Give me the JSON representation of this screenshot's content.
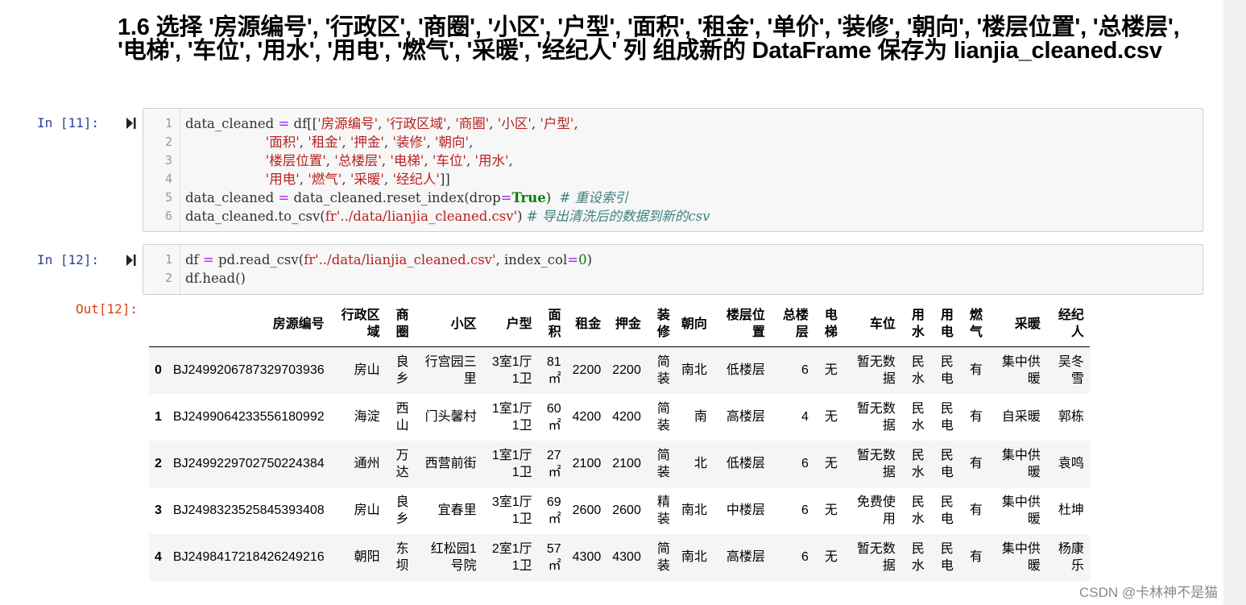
{
  "heading": "1.6  选择 '房源编号', '行政区', '商圈', '小区', '户型', '面积', '租金', '单价', '装修', '朝向', '楼层位置', '总楼层', '电梯', '车位', '用水', '用电', '燃气', '采暖', '经纪人' 列 组成新的 DataFrame 保存为 lianjia_cleaned.csv",
  "cells": [
    {
      "prompt": "In  [11]:",
      "line_numbers": [
        "1",
        "2",
        "3",
        "4",
        "5",
        "6"
      ],
      "lines": [
        [
          [
            "p",
            "data_cleaned "
          ],
          [
            "o",
            "="
          ],
          [
            "p",
            " df[["
          ],
          [
            "s",
            "'房源编号'"
          ],
          [
            "p",
            ", "
          ],
          [
            "s",
            "'行政区域'"
          ],
          [
            "p",
            ", "
          ],
          [
            "s",
            "'商圈'"
          ],
          [
            "p",
            ", "
          ],
          [
            "s",
            "'小区'"
          ],
          [
            "p",
            ", "
          ],
          [
            "s",
            "'户型'"
          ],
          [
            "p",
            ","
          ]
        ],
        [
          [
            "p",
            "                   "
          ],
          [
            "s",
            "'面积'"
          ],
          [
            "p",
            ", "
          ],
          [
            "s",
            "'租金'"
          ],
          [
            "p",
            ", "
          ],
          [
            "s",
            "'押金'"
          ],
          [
            "p",
            ", "
          ],
          [
            "s",
            "'装修'"
          ],
          [
            "p",
            ", "
          ],
          [
            "s",
            "'朝向'"
          ],
          [
            "p",
            ","
          ]
        ],
        [
          [
            "p",
            "                   "
          ],
          [
            "s",
            "'楼层位置'"
          ],
          [
            "p",
            ", "
          ],
          [
            "s",
            "'总楼层'"
          ],
          [
            "p",
            ", "
          ],
          [
            "s",
            "'电梯'"
          ],
          [
            "p",
            ", "
          ],
          [
            "s",
            "'车位'"
          ],
          [
            "p",
            ", "
          ],
          [
            "s",
            "'用水'"
          ],
          [
            "p",
            ","
          ]
        ],
        [
          [
            "p",
            "                   "
          ],
          [
            "s",
            "'用电'"
          ],
          [
            "p",
            ", "
          ],
          [
            "s",
            "'燃气'"
          ],
          [
            "p",
            ", "
          ],
          [
            "s",
            "'采暖'"
          ],
          [
            "p",
            ", "
          ],
          [
            "s",
            "'经纪人'"
          ],
          [
            "p",
            "]]"
          ]
        ],
        [
          [
            "p",
            "data_cleaned "
          ],
          [
            "o",
            "="
          ],
          [
            "p",
            " data_cleaned.reset_index(drop"
          ],
          [
            "o",
            "="
          ],
          [
            "k",
            "True"
          ],
          [
            "p",
            ")  "
          ],
          [
            "c",
            "# 重设索引"
          ]
        ],
        [
          [
            "p",
            "data_cleaned.to_csv("
          ],
          [
            "s",
            "fr'../data/lianjia_cleaned.csv'"
          ],
          [
            "p",
            ") "
          ],
          [
            "c",
            "# 导出清洗后的数据到新的csv"
          ]
        ]
      ]
    },
    {
      "prompt": "In  [12]:",
      "line_numbers": [
        "1",
        "2"
      ],
      "lines": [
        [
          [
            "p",
            "df "
          ],
          [
            "o",
            "="
          ],
          [
            "p",
            " pd.read_csv("
          ],
          [
            "s",
            "fr'../data/lianjia_cleaned.csv'"
          ],
          [
            "p",
            ", index_col"
          ],
          [
            "o",
            "="
          ],
          [
            "n",
            "0"
          ],
          [
            "p",
            ")"
          ]
        ],
        [
          [
            "p",
            "df.head()"
          ]
        ]
      ]
    }
  ],
  "output_prompt": "Out[12]:",
  "table": {
    "columns": [
      "房源编号",
      "行政区域",
      "商圈",
      "小区",
      "户型",
      "面积",
      "租金",
      "押金",
      "装修",
      "朝向",
      "楼层位置",
      "总楼层",
      "电梯",
      "车位",
      "用水",
      "用电",
      "燃气",
      "采暖",
      "经纪人"
    ],
    "rows": [
      {
        "index": "0",
        "cells": [
          "BJ2499206787329703936",
          "房山",
          "良乡",
          "行宫园三里",
          "3室1厅1卫",
          "81㎡",
          "2200",
          "2200",
          "简装",
          "南北",
          "低楼层",
          "6",
          "无",
          "暂无数据",
          "民水",
          "民电",
          "有",
          "集中供暖",
          "吴冬雪"
        ]
      },
      {
        "index": "1",
        "cells": [
          "BJ2499064233556180992",
          "海淀",
          "西山",
          "门头馨村",
          "1室1厅1卫",
          "60㎡",
          "4200",
          "4200",
          "简装",
          "南",
          "高楼层",
          "4",
          "无",
          "暂无数据",
          "民水",
          "民电",
          "有",
          "自采暖",
          "郭栋"
        ]
      },
      {
        "index": "2",
        "cells": [
          "BJ2499229702750224384",
          "通州",
          "万达",
          "西营前街",
          "1室1厅1卫",
          "27㎡",
          "2100",
          "2100",
          "简装",
          "北",
          "低楼层",
          "6",
          "无",
          "暂无数据",
          "民水",
          "民电",
          "有",
          "集中供暖",
          "袁鸣"
        ]
      },
      {
        "index": "3",
        "cells": [
          "BJ2498323525845393408",
          "房山",
          "良乡",
          "宜春里",
          "3室1厅1卫",
          "69㎡",
          "2600",
          "2600",
          "精装",
          "南北",
          "中楼层",
          "6",
          "无",
          "免费使用",
          "民水",
          "民电",
          "有",
          "集中供暖",
          "杜坤"
        ]
      },
      {
        "index": "4",
        "cells": [
          "BJ2498417218426249216",
          "朝阳",
          "东坝",
          "红松园1号院",
          "2室1厅1卫",
          "57㎡",
          "4300",
          "4300",
          "简装",
          "南北",
          "高楼层",
          "6",
          "无",
          "暂无数据",
          "民水",
          "民电",
          "有",
          "集中供暖",
          "杨康乐"
        ]
      }
    ]
  },
  "watermark": "CSDN @卡林神不是猫",
  "colors": {
    "prompt_in": "#303f9f",
    "prompt_out": "#d84315",
    "string": "#ba2121",
    "keyword": "#008000",
    "comment": "#408080",
    "operator": "#aa22ff"
  },
  "icons": {
    "run": "run-cell-icon"
  }
}
